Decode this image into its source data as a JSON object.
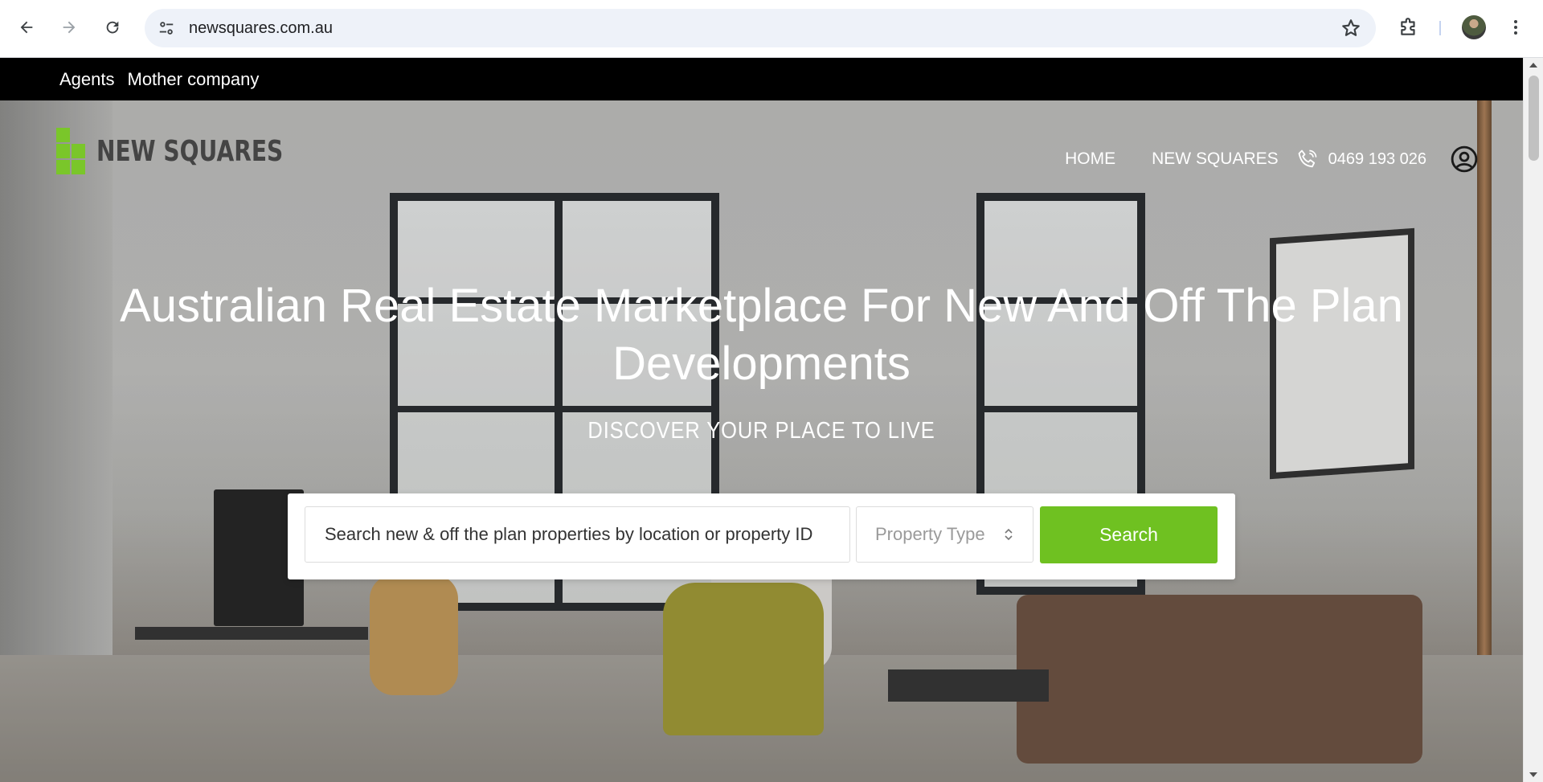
{
  "browser": {
    "url": "newsquares.com.au",
    "back_icon": "arrow-left-icon",
    "forward_icon": "arrow-right-icon",
    "reload_icon": "reload-icon",
    "site_info_icon": "tune-icon",
    "bookmark_icon": "star-icon",
    "extensions_icon": "puzzle-icon",
    "menu_icon": "kebab-menu-icon"
  },
  "topbar": {
    "links": [
      {
        "label": "Agents"
      },
      {
        "label": "Mother company"
      }
    ]
  },
  "header": {
    "logo_text": "NEW SQUARES",
    "nav": [
      {
        "label": "HOME"
      },
      {
        "label": "NEW SQUARES"
      }
    ],
    "phone": "0469 193 026"
  },
  "hero": {
    "title": "Australian Real Estate Marketplace For New And Off The Plan Developments",
    "tagline": "DISCOVER YOUR PLACE TO LIVE"
  },
  "search": {
    "placeholder": "Search new & off the plan properties by location or property ID",
    "property_type": "Property Type",
    "button": "Search"
  },
  "colors": {
    "accent": "#6fc121",
    "logo_green": "#7ac62a",
    "topbar": "#000000"
  }
}
